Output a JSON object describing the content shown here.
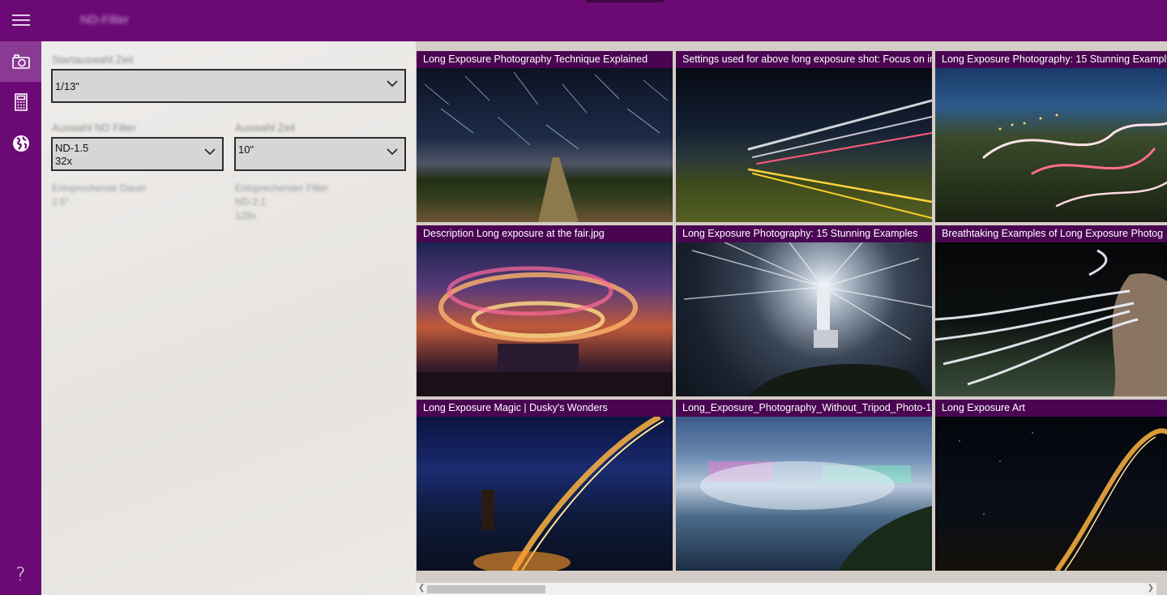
{
  "app": {
    "title": "ND-Filter"
  },
  "rail": [
    {
      "name": "hamburger-menu-icon"
    },
    {
      "name": "camera-icon",
      "active": true
    },
    {
      "name": "calculator-icon"
    },
    {
      "name": "globe-icon"
    },
    {
      "name": "help-icon",
      "glyph": "?"
    }
  ],
  "form": {
    "start_label": "Startauswahl Zeit",
    "start_value": "1/13\"",
    "nd_label": "Auswahl ND Filter",
    "nd_value_line1": "ND-1.5",
    "nd_value_line2": "32x",
    "time_label": "Auswahl Zeit",
    "time_value": "10\"",
    "result_duration_label": "Entsprechende Dauer",
    "result_duration_value": "2.5\"",
    "result_filter_label": "Entsprechender Filter",
    "result_filter_line1": "ND-2.1",
    "result_filter_line2": "128x"
  },
  "gallery": [
    {
      "caption": "Long Exposure Photography Technique Explained"
    },
    {
      "caption": "Settings used for above long exposure shot: Focus on inf"
    },
    {
      "caption": "Long Exposure Photography: 15 Stunning Exampl"
    },
    {
      "caption": "Description Long exposure at the fair.jpg"
    },
    {
      "caption": "Long Exposure Photography: 15 Stunning Examples"
    },
    {
      "caption": "Breathtaking Examples of Long Exposure Photog"
    },
    {
      "caption": "Long Exposure Magic | Dusky's Wonders"
    },
    {
      "caption": "Long_Exposure_Photography_Without_Tripod_Photo-1"
    },
    {
      "caption": "Long Exposure Art"
    }
  ],
  "colors": {
    "accent": "#6c0a75",
    "caption_bg": "#4a0552",
    "rail_active": "#8a3a93"
  }
}
